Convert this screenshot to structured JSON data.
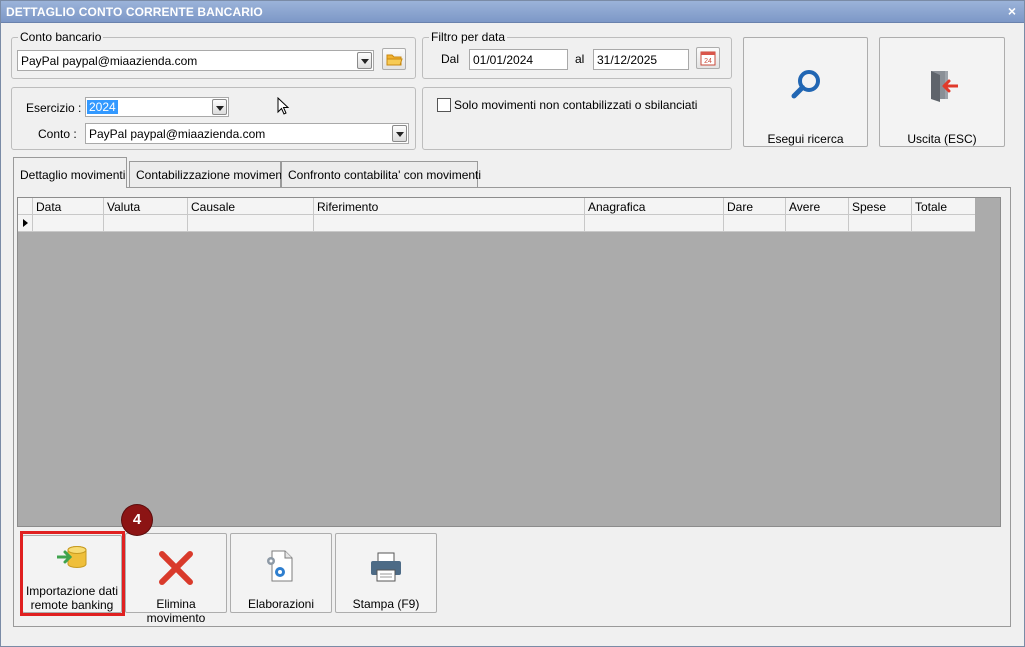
{
  "window": {
    "title": "DETTAGLIO CONTO CORRENTE BANCARIO",
    "close_glyph": "×"
  },
  "conto_bancario": {
    "legend": "Conto bancario",
    "value": "PayPal paypal@miaazienda.com",
    "folder_icon": "folder-icon"
  },
  "filtro_data": {
    "legend": "Filtro per data",
    "dal_label": "Dal",
    "dal_value": "01/01/2024",
    "al_label": "al",
    "al_value": "31/12/2025",
    "calendar_icon": "calendar-icon",
    "calendar_day": "24"
  },
  "esercizio": {
    "label": "Esercizio :",
    "value": "2024",
    "conto_label": "Conto :",
    "conto_value": "PayPal paypal@miaazienda.com"
  },
  "filter_option": {
    "label": "Solo movimenti non contabilizzati o sbilanciati",
    "checked": false
  },
  "actions": {
    "search_label": "Esegui ricerca",
    "exit_label": "Uscita (ESC)"
  },
  "tabs": [
    {
      "label": "Dettaglio movimenti",
      "active": true
    },
    {
      "label": "Contabilizzazione movimenti",
      "active": false
    },
    {
      "label": "Confronto contabilita' con movimenti",
      "active": false
    }
  ],
  "grid": {
    "columns": [
      "Data",
      "Valuta",
      "Causale",
      "Riferimento",
      "Anagrafica",
      "Dare",
      "Avere",
      "Spese",
      "Totale"
    ],
    "rows": []
  },
  "bottom_buttons": {
    "import_label_1": "Importazione dati",
    "import_label_2": "remote banking",
    "delete_label": "Elimina movimento",
    "process_label": "Elaborazioni",
    "print_label": "Stampa (F9)"
  },
  "annotation": {
    "step_number": "4",
    "color": "#e02020"
  },
  "colors": {
    "title_bar": "#7d98c7",
    "selection": "#3399ff",
    "grid_background": "#ababab",
    "delete_red": "#d93a2b",
    "search_blue": "#2166b3"
  }
}
